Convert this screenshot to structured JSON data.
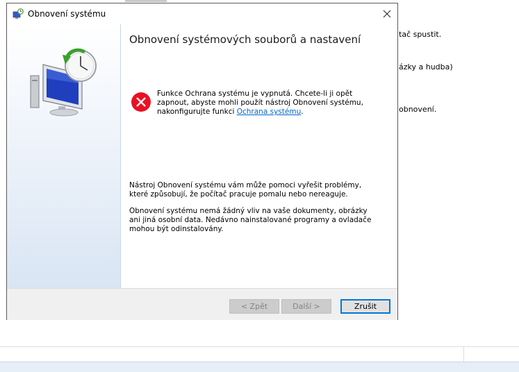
{
  "background": {
    "lines": [
      "tač spustit.",
      "ázky a hudba)",
      "obnovení."
    ]
  },
  "dialog": {
    "title": "Obnovení systému",
    "heading": "Obnovení systémových souborů a nastavení",
    "error": {
      "text_before_link": "Funkce Ochrana systému je vypnutá. Chcete-li ji opět zapnout, abyste mohli použít nástroj Obnovení systému, nakonfigurujte funkci ",
      "link": "Ochrana systému",
      "text_after_link": "."
    },
    "paragraph1": "Nástroj Obnovení systému vám může pomoci vyřešit problémy, které způsobují, že počítač pracuje pomalu nebo nereaguje.",
    "paragraph2": "Obnovení systému nemá žádný vliv na vaše dokumenty, obrázky ani jiná osobní data. Nedávno nainstalované programy a ovladače mohou být odinstalovány.",
    "buttons": {
      "back": "< Zpět",
      "next": "Další >",
      "cancel": "Zrušit"
    }
  },
  "colors": {
    "accent": "#0078d7",
    "error": "#e81123",
    "link": "#0066cc"
  },
  "icons": {
    "title": "system-restore-icon",
    "close": "close-icon",
    "error": "error-icon",
    "sidebar": "system-restore-illustration"
  }
}
